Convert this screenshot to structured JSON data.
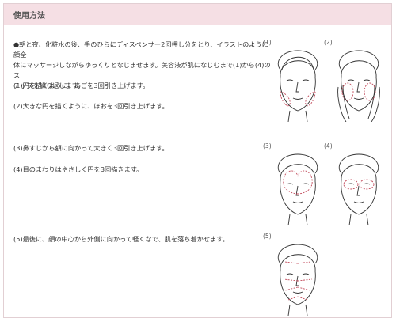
{
  "header": {
    "title": "使用方法"
  },
  "intro": "●朝と夜、化粧水の後、手のひらにディスペンサー2回押し分をとり、イラストのように顔全\n体にマッサージしながらゆっくりとなじませます。美容液が肌になじむまで(1)から(4)のス\nテップを繰り返します。",
  "steps": [
    {
      "text": "(1)円を描くように、あごを3回引き上げます。"
    },
    {
      "text": "(2)大きな円を描くように、ほおを3回引き上げます。"
    },
    {
      "text": "(3)鼻すじから額に向かって大きく3回引き上げます。"
    },
    {
      "text": "(4)目のまわりはやさしく円を3回描きます。"
    },
    {
      "text": "(5)最後に、顔の中心から外側に向かって軽くなで、肌を落ち着かせます。"
    }
  ],
  "figures": [
    {
      "label": "(1)"
    },
    {
      "label": "(2)"
    },
    {
      "label": "(3)"
    },
    {
      "label": "(4)"
    },
    {
      "label": "(5)"
    }
  ],
  "colors": {
    "header_bg": "#f5dfe4",
    "border": "#e2cfd3",
    "stroke_accent": "#c24a5b"
  }
}
